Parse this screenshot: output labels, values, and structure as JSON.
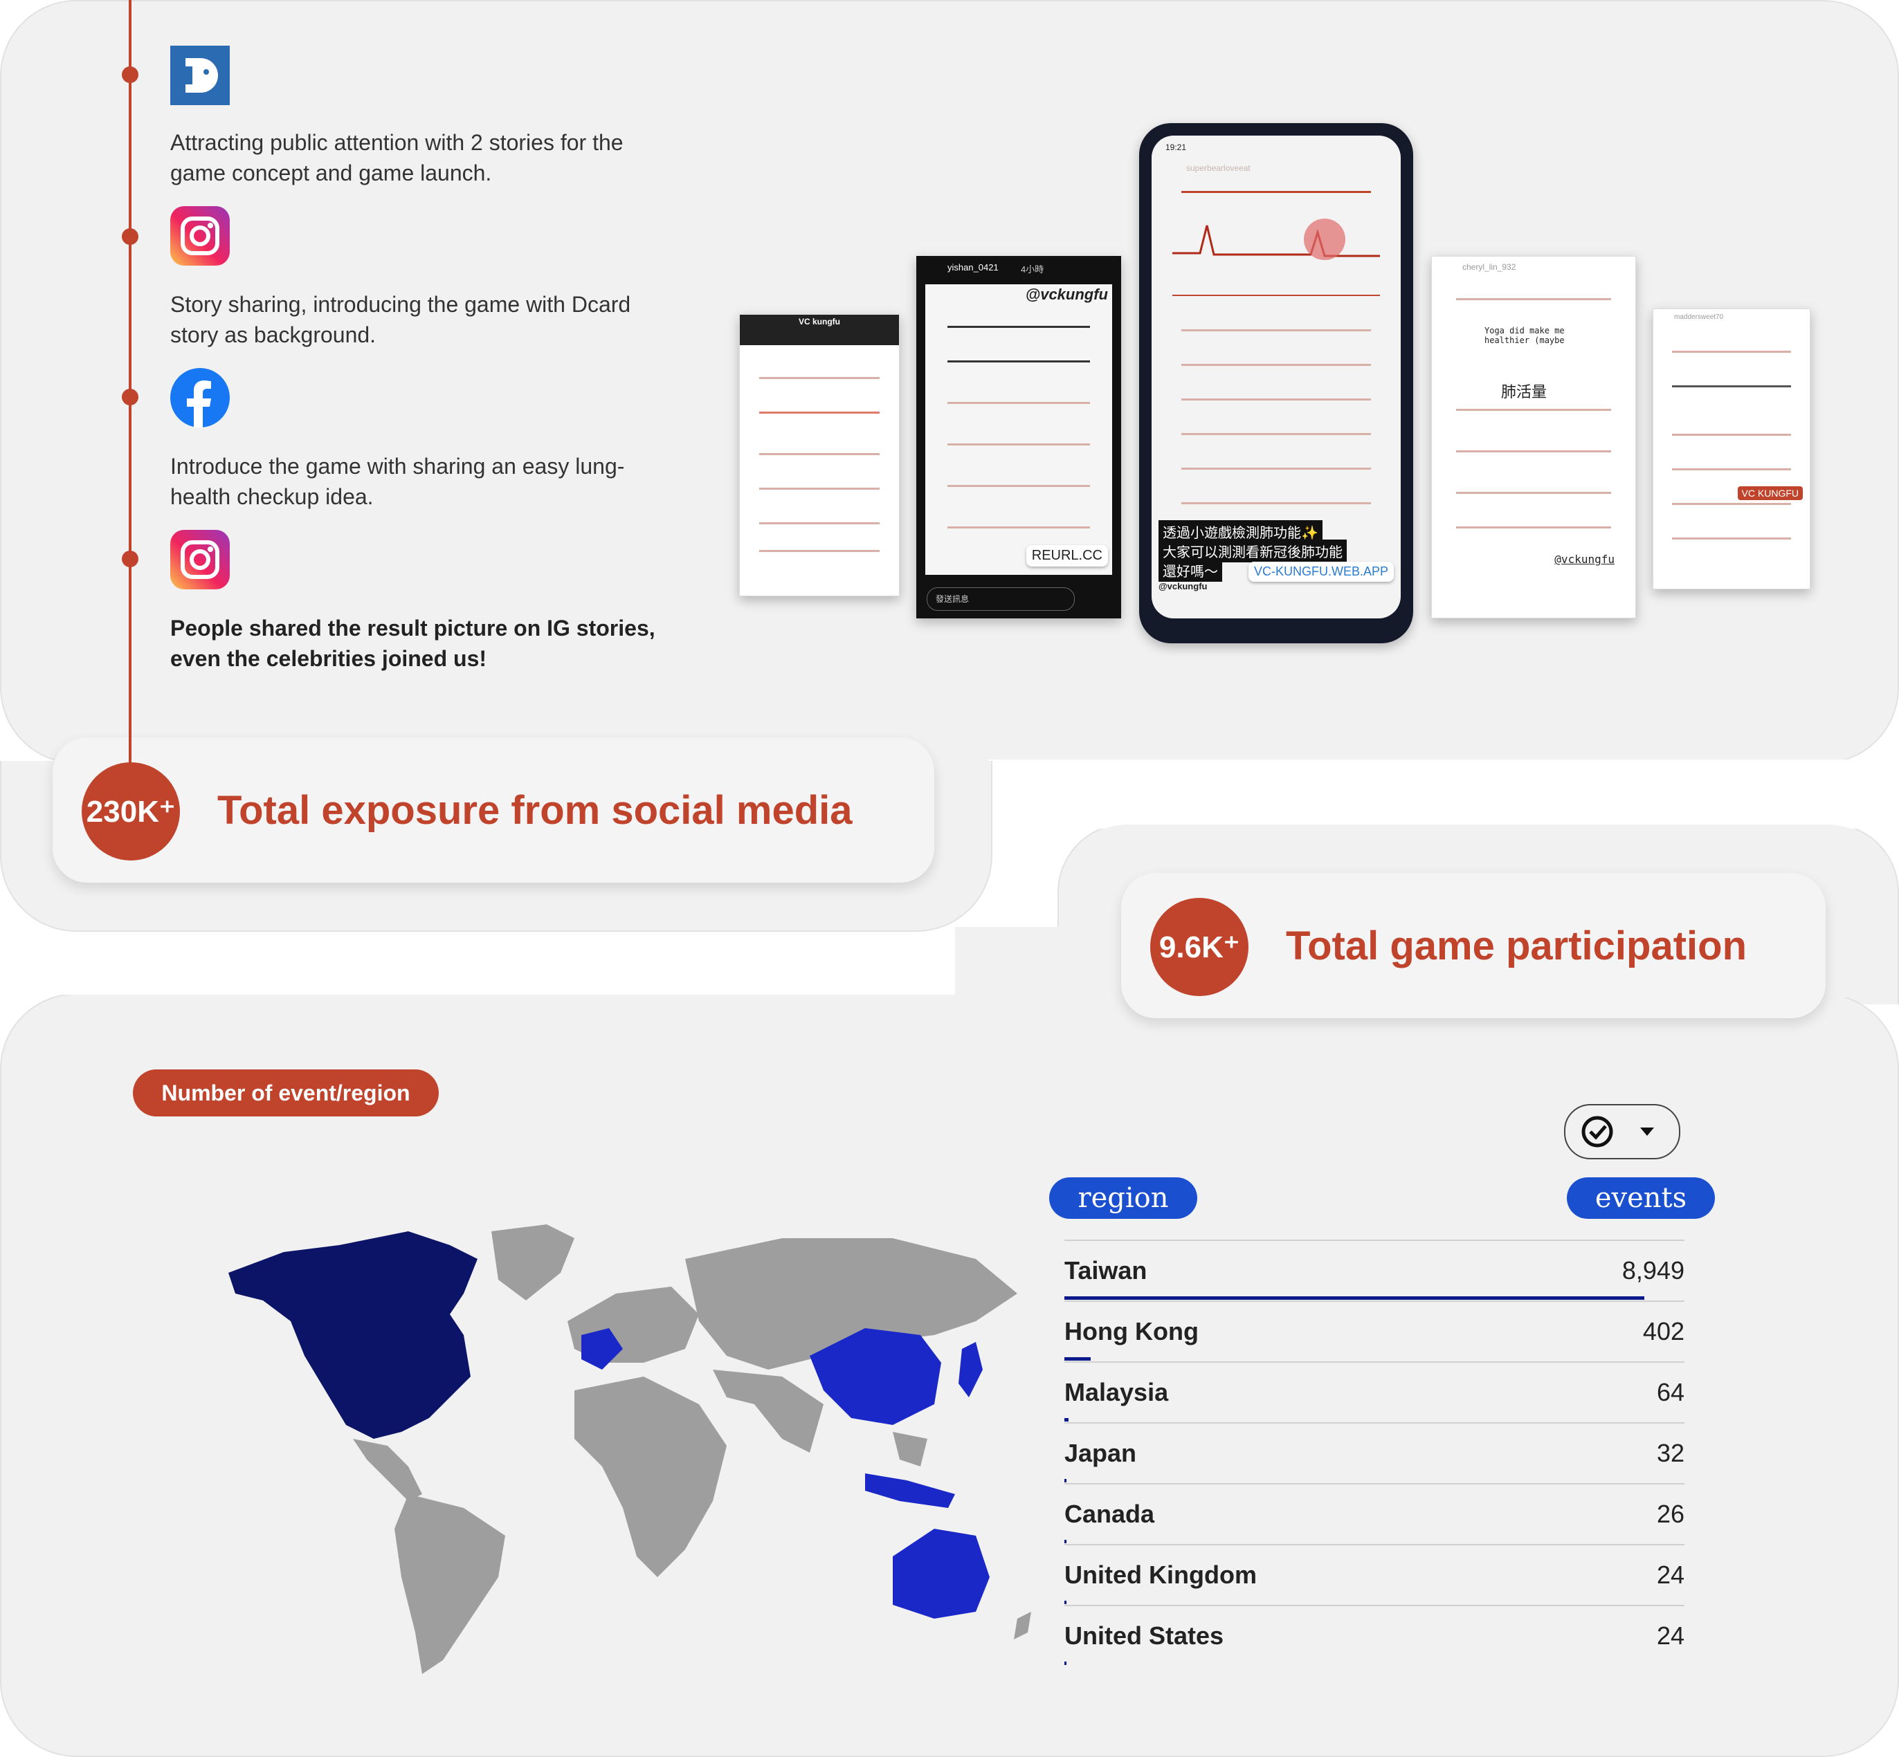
{
  "timeline": [
    {
      "icon": "dcard-icon",
      "text": "Attracting public attention with 2 stories for the game concept and game launch."
    },
    {
      "icon": "instagram-icon",
      "text": "Story sharing, introducing the game with Dcard story as background."
    },
    {
      "icon": "facebook-icon",
      "text": "Introduce the game with sharing an easy lung-health checkup idea."
    },
    {
      "icon": "instagram-icon",
      "text": "People shared the result picture on IG stories, even the celebrities joined us!"
    }
  ],
  "stats": {
    "exposure": {
      "value": "230K⁺",
      "label": "Total exposure from social media"
    },
    "participation": {
      "value": "9.6K⁺",
      "label": "Total game participation"
    }
  },
  "phones": {
    "center_time": "19:21",
    "center_handle": "superbearloveeat",
    "center_caption_1": "透過小遊戲檢測肺功能✨",
    "center_caption_2": "大家可以測測看新冠後肺功能",
    "center_caption_3": "還好嗎～",
    "center_link": "VC-KUNGFU.WEB.APP",
    "center_tag": "@vckungfu",
    "left2_handle": "yishan_0421",
    "left2_time": "4小時",
    "left2_tag": "@vckungfu",
    "left2_link": "REURL.CC",
    "left2_input": "發送訊息",
    "left1_title": "VC kungfu",
    "right1_handle": "cheryl_lin_932",
    "right1_text": "Yoga did make me healthier (maybe",
    "right1_label": "肺活量",
    "right1_tag": "@vckungfu",
    "right2_handle": "maddersweet70",
    "right2_link": "VC KUNGFU"
  },
  "map_section": {
    "title": "Number of event/region",
    "col_region": "region",
    "col_events": "events",
    "rows": [
      {
        "name": "Taiwan",
        "value": "8,949",
        "n": 8949
      },
      {
        "name": "Hong Kong",
        "value": "402",
        "n": 402
      },
      {
        "name": "Malaysia",
        "value": "64",
        "n": 64
      },
      {
        "name": "Japan",
        "value": "32",
        "n": 32
      },
      {
        "name": "Canada",
        "value": "26",
        "n": 26
      },
      {
        "name": "United Kingdom",
        "value": "24",
        "n": 24
      },
      {
        "name": "United States",
        "value": "24",
        "n": 24
      }
    ]
  },
  "colors": {
    "accent": "#c0432c",
    "map_dark": "#0b1466",
    "map_mid": "#1a28c8",
    "map_grey": "#9e9e9e",
    "pill_blue": "#1a4fd0"
  }
}
